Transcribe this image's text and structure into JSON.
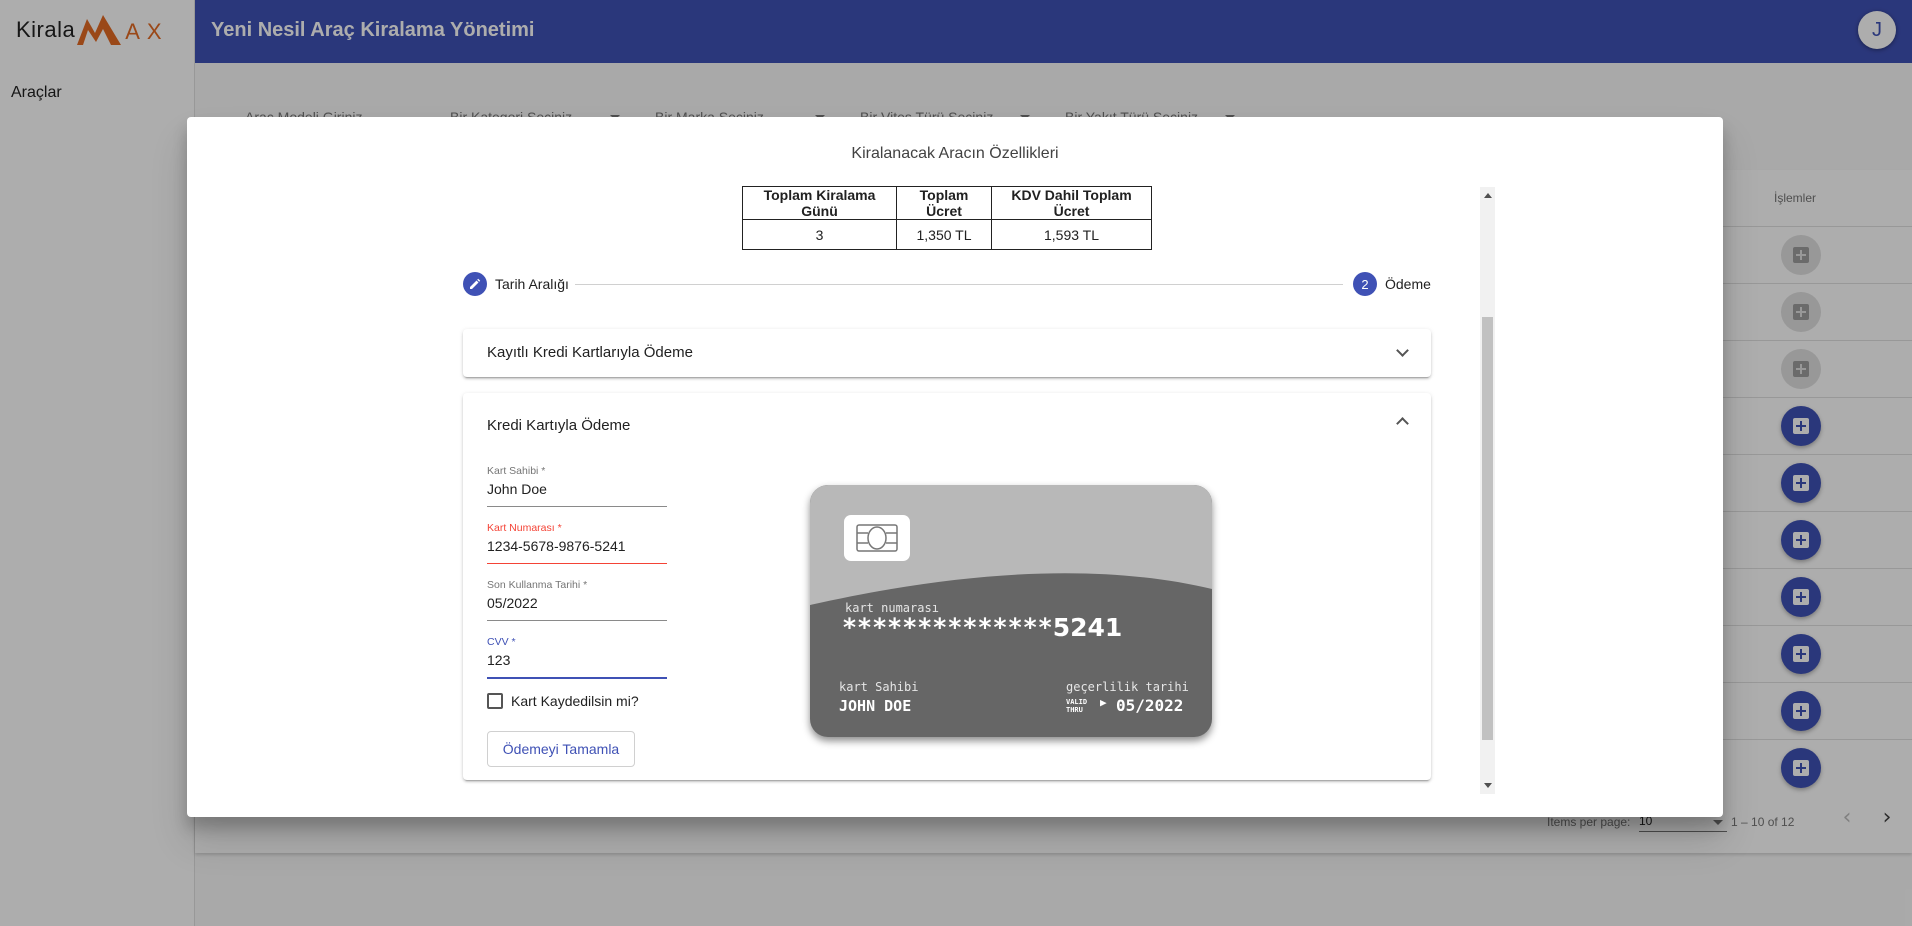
{
  "app": {
    "logo_kirala": "Kirala",
    "logo_ax": "AX",
    "title": "Yeni Nesil Araç Kiralama Yönetimi",
    "avatar_initial": "J"
  },
  "sidebar": {
    "items": [
      {
        "label": "Araçlar"
      }
    ]
  },
  "filters": {
    "model_placeholder": "Araç Modeli Giriniz",
    "category": "Bir Kategori Seçiniz",
    "brand": "Bir Marka Seçiniz",
    "gear": "Bir Vites Türü Seçiniz",
    "fuel": "Bir Yakıt Türü Seçiniz"
  },
  "table": {
    "actions_header": "İşlemler",
    "row_button_states": [
      "disabled",
      "disabled",
      "disabled",
      "enabled",
      "enabled",
      "enabled",
      "enabled",
      "enabled",
      "enabled",
      "enabled"
    ]
  },
  "paginator": {
    "items_per_page_label": "Items per page:",
    "page_size": "10",
    "range": "1 – 10 of 12"
  },
  "dialog": {
    "title": "Kiralanacak Aracın Özellikleri",
    "summary": {
      "headers": [
        "Toplam Kiralama Günü",
        "Toplam Ücret",
        "KDV Dahil Toplam Ücret"
      ],
      "values": [
        "3",
        "1,350 TL",
        "1,593 TL"
      ]
    },
    "stepper": {
      "steps": [
        {
          "label": "Tarih Aralığı",
          "state": "edit",
          "icon": "pencil-icon"
        },
        {
          "label": "Ödeme",
          "number": "2",
          "state": "active"
        }
      ]
    },
    "saved_cards_panel": {
      "title": "Kayıtlı Kredi Kartlarıyla Ödeme",
      "expanded": false
    },
    "card_panel": {
      "title": "Kredi Kartıyla Ödeme",
      "expanded": true,
      "fields": {
        "holder": {
          "label": "Kart Sahibi *",
          "value": "John Doe"
        },
        "number": {
          "label": "Kart Numarası *",
          "value": "1234-5678-9876-5241",
          "state": "error"
        },
        "expiry": {
          "label": "Son Kullanma Tarihi *",
          "value": "05/2022"
        },
        "cvv": {
          "label": "CVV *",
          "value": "123",
          "state": "focused"
        }
      },
      "save_card_label": "Kart Kaydedilsin mi?",
      "save_card_checked": false,
      "complete_button": "Ödemeyi Tamamla"
    },
    "card_preview": {
      "number_label": "kart numarası",
      "masked_number": "**************",
      "last_digits": "5241",
      "holder_label": "kart Sahibi",
      "holder_name": "JOHN DOE",
      "validity_label": "geçerlilik tarihi",
      "valid": "VALID",
      "thru": "THRU",
      "expiry": "05/2022"
    }
  },
  "colors": {
    "primary": "#3f51b5",
    "logo_accent": "#e46a24",
    "error": "#f44336"
  }
}
